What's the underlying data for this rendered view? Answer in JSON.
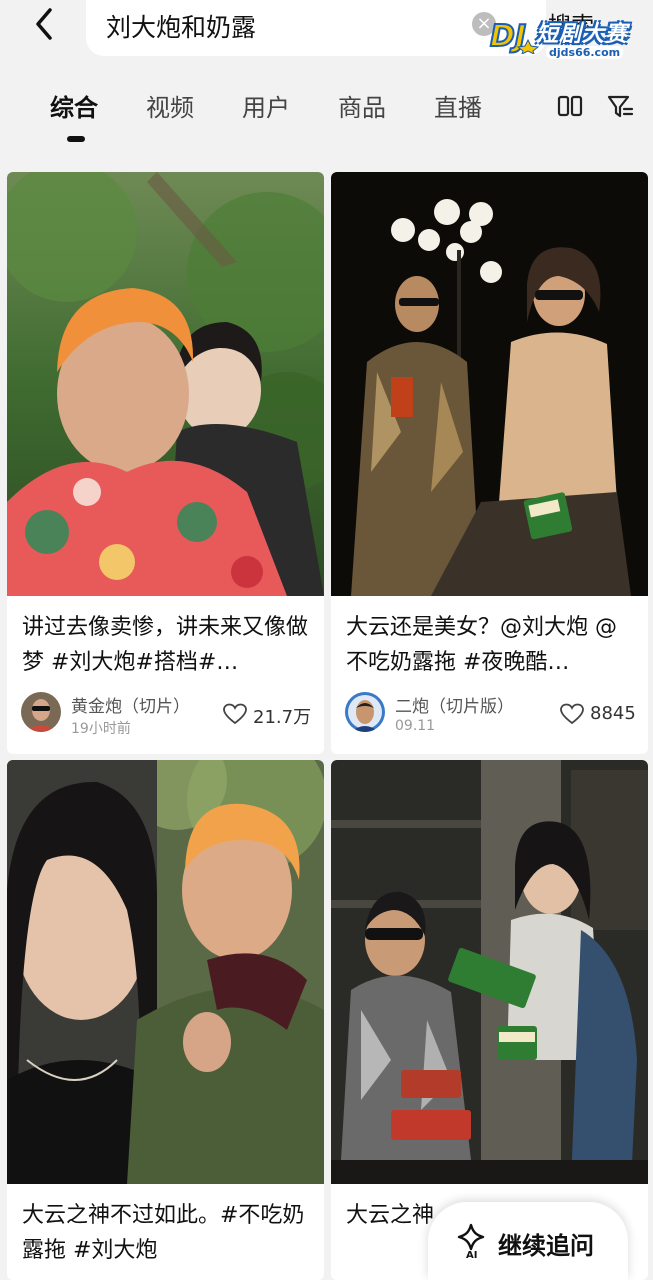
{
  "search": {
    "query": "刘大炮和奶露",
    "submit_label": "搜索",
    "clear_glyph": "×"
  },
  "watermark": {
    "title": "短剧大赛",
    "url": "djds66.com"
  },
  "tabs": [
    {
      "label": "综合",
      "active": true
    },
    {
      "label": "视频",
      "active": false
    },
    {
      "label": "用户",
      "active": false
    },
    {
      "label": "商品",
      "active": false
    },
    {
      "label": "直播",
      "active": false
    }
  ],
  "tab_icons": [
    "grid-layout-icon",
    "filter-icon"
  ],
  "results": [
    {
      "title": "讲过去像卖惨，讲未来又像做梦 #刘大炮#搭档#…",
      "author": "黄金炮（切片）",
      "time": "19小时前",
      "likes": "21.7万"
    },
    {
      "title": "大云还是美女？@刘大炮 @不吃奶露拖 #夜晚酷…",
      "author": "二炮（切片版）",
      "time": "09.11",
      "likes": "8845"
    },
    {
      "title": "大云之神不过如此。#不吃奶露拖 #刘大炮",
      "author": "",
      "time": "",
      "likes": ""
    },
    {
      "title": "大云之神…吃奶露…",
      "author": "",
      "time": "",
      "likes": ""
    }
  ],
  "ai_button": {
    "label": "继续追问",
    "icon_text": "AI"
  },
  "colors": {
    "background": "#f2f2f2",
    "card": "#ffffff",
    "watermark_blue": "#1a5fb4"
  }
}
